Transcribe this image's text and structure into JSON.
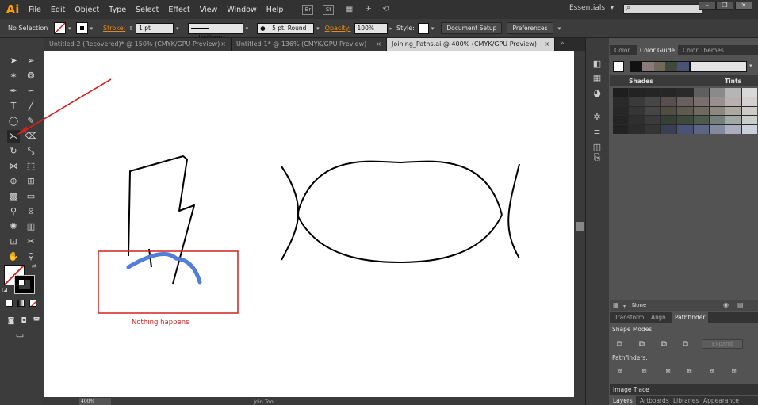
{
  "app": {
    "logo": "Ai",
    "menu": [
      "File",
      "Edit",
      "Object",
      "Type",
      "Select",
      "Effect",
      "View",
      "Window",
      "Help"
    ],
    "menu_icons": [
      "Br",
      "St"
    ],
    "workspace": "Essentials",
    "search_placeholder": ""
  },
  "control_bar": {
    "selection": "No Selection",
    "stroke_label": "Stroke:",
    "stroke_weight": "1 pt",
    "stroke_profile": "Uniform",
    "brush": "5 pt. Round",
    "opacity_label": "Opacity:",
    "opacity_value": "100%",
    "style_label": "Style:",
    "document_setup": "Document Setup",
    "preferences": "Preferences"
  },
  "tabs": [
    {
      "label": "Untitled-2 (Recovered)* @ 150% (CMYK/GPU Preview)",
      "active": false
    },
    {
      "label": "Untitled-1* @ 136% (CMYK/GPU Preview)",
      "active": false
    },
    {
      "label": "Joining_Paths.ai @ 400% (CMYK/GPU Preview)",
      "active": true
    }
  ],
  "canvas": {
    "annotation": "Nothing happens",
    "highlight_color": "#d42121",
    "blue_stroke_color": "#4f7fd8",
    "arrow_color": "#d42121"
  },
  "status": {
    "zoom": "400%",
    "tool": "Join Tool"
  },
  "color_panel": {
    "tabs": [
      "Color",
      "Color Guide",
      "Color Themes"
    ],
    "active_tab": "Color Guide",
    "harmony_colors": [
      "#111111",
      "#8a7a7a",
      "#6f6a5a",
      "#3d4a3d",
      "#4a5275"
    ],
    "shades_label": "Shades",
    "tints_label": "Tints",
    "grid_colors": [
      [
        "#1e1e1e",
        "#232323",
        "#252525",
        "#262626",
        "#2a2a2a",
        "#5f5f5f",
        "#8a8a8a",
        "#b5b5b5",
        "#d8d8d8"
      ],
      [
        "#2a2a2a",
        "#3a3a3a",
        "#474747",
        "#5a4f4f",
        "#6a5f5f",
        "#7a6f6f",
        "#9a8f8f",
        "#b8b0b0",
        "#d4cfcf"
      ],
      [
        "#272727",
        "#353535",
        "#464646",
        "#514d45",
        "#5f5a50",
        "#6e6a5f",
        "#8c887f",
        "#aca9a2",
        "#cdcbc7"
      ],
      [
        "#242424",
        "#2f2f2f",
        "#3b3b3b",
        "#334033",
        "#3d4a3d",
        "#4e5a4e",
        "#76807a",
        "#a2a9a4",
        "#c8cdc9"
      ],
      [
        "#222222",
        "#2c2c2c",
        "#353535",
        "#3a3f55",
        "#4a5275",
        "#5d6585",
        "#83899f",
        "#a9adbd",
        "#cccfda"
      ]
    ],
    "footer_label": "None"
  },
  "pathfinder_panel": {
    "tabs": [
      "Transform",
      "Align",
      "Pathfinder"
    ],
    "active_tab": "Pathfinder",
    "shape_modes_label": "Shape Modes:",
    "pathfinders_label": "Pathfinders:",
    "expand": "Expand"
  },
  "image_trace": {
    "label": "Image Trace"
  },
  "bottom_tabs": [
    "Layers",
    "Artboards",
    "Libraries",
    "Appearance"
  ]
}
